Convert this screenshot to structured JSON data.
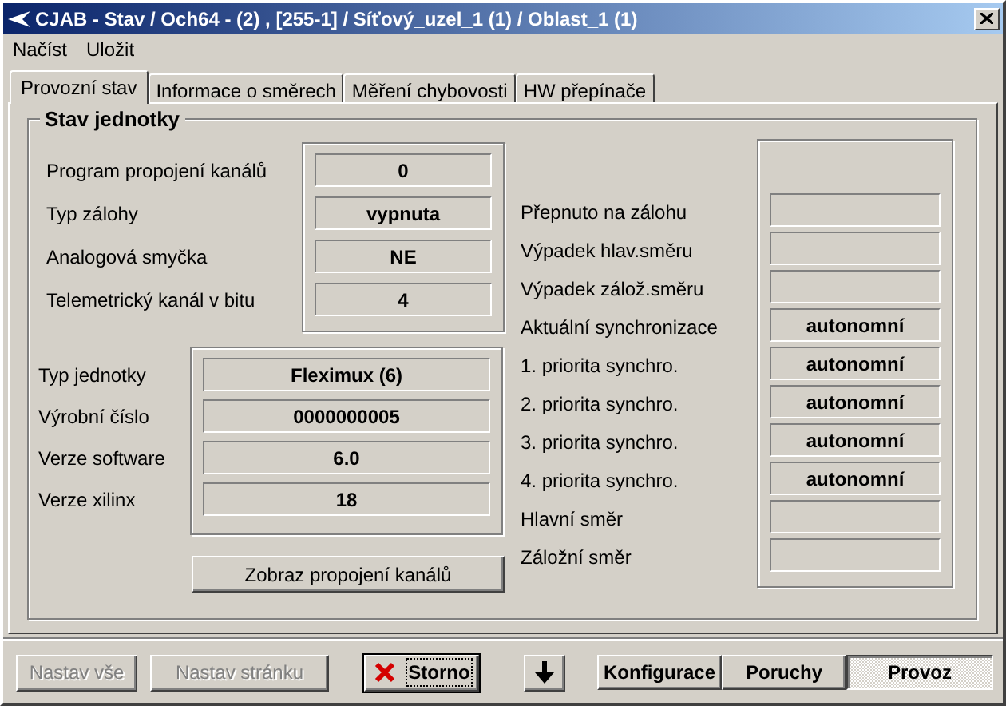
{
  "window": {
    "title": "CJAB - Stav / Och64 - (2) , [255-1] / Síťový_uzel_1 (1) / Oblast_1 (1)"
  },
  "menu": [
    {
      "label": "Načíst"
    },
    {
      "label": "Uložit"
    }
  ],
  "tabs": [
    {
      "label": "Provozní stav",
      "selected": true
    },
    {
      "label": "Informace o směrech",
      "selected": false
    },
    {
      "label": "Měření chybovosti",
      "selected": false
    },
    {
      "label": "HW přepínače",
      "selected": false
    }
  ],
  "group": {
    "title": "Stav jednotky",
    "settings": [
      {
        "label": "Program propojení kanálů",
        "value": "0"
      },
      {
        "label": "Typ zálohy",
        "value": "vypnuta"
      },
      {
        "label": "Analogová smyčka",
        "value": "NE"
      },
      {
        "label": "Telemetrický kanál v bitu",
        "value": "4"
      }
    ],
    "unit_info": [
      {
        "label": "Typ jednotky",
        "value": "Fleximux (6)"
      },
      {
        "label": "Výrobní číslo",
        "value": "0000000005"
      },
      {
        "label": "Verze software",
        "value": "6.0"
      },
      {
        "label": "Verze xilinx",
        "value": "18"
      }
    ],
    "show_button": "Zobraz propojení kanálů",
    "status": [
      {
        "label": "Přepnuto na zálohu"
      },
      {
        "label": "Výpadek hlav.směru"
      },
      {
        "label": "Výpadek zálož.směru"
      },
      {
        "label": "Aktuální synchronizace",
        "value": "autonomní"
      },
      {
        "label": "1. priorita synchro.",
        "value": "autonomní"
      },
      {
        "label": "2. priorita synchro.",
        "value": "autonomní"
      },
      {
        "label": "3. priorita synchro.",
        "value": "autonomní"
      },
      {
        "label": "4. priorita synchro.",
        "value": "autonomní"
      },
      {
        "label": "Hlavní směr"
      },
      {
        "label": "Záložní směr"
      }
    ]
  },
  "footer": {
    "actions": [
      {
        "kind": "text",
        "label": "Nastav vše",
        "disabled": true
      },
      {
        "kind": "text",
        "label": "Nastav stránku",
        "disabled": true
      },
      {
        "kind": "cancel",
        "label": "Storno",
        "disabled": false
      },
      {
        "kind": "arrow",
        "disabled": false
      }
    ],
    "modes": [
      {
        "label": "Konfigurace",
        "selected": false
      },
      {
        "label": "Poruchy",
        "selected": false
      },
      {
        "label": "Provoz",
        "selected": true
      }
    ]
  }
}
